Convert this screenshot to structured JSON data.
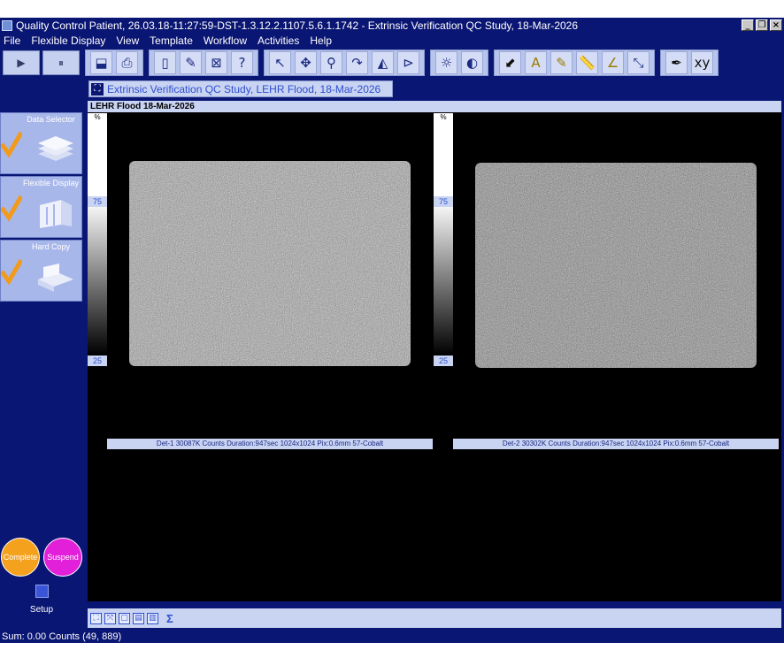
{
  "window": {
    "title": "Quality Control Patient, 26.03.18-11:27:59-DST-1.3.12.2.1107.5.6.1.1742 - Extrinsic Verification QC Study, 18-Mar-2026",
    "min_glyph": "_",
    "max_glyph": "❐",
    "close_glyph": "×"
  },
  "menu": [
    "File",
    "Flexible Display",
    "View",
    "Template",
    "Workflow",
    "Activities",
    "Help"
  ],
  "toolbar": {
    "play_glyph": "▶",
    "pause_glyph": "⏸",
    "groups": [
      [
        {
          "icon": "save-icon",
          "glyph": "⬓"
        },
        {
          "icon": "print-icon",
          "glyph": "⎙"
        }
      ],
      [
        {
          "icon": "new-doc-icon",
          "glyph": "▯"
        },
        {
          "icon": "edit-doc-icon",
          "glyph": "✎"
        },
        {
          "icon": "close-doc-icon",
          "glyph": "⊠"
        },
        {
          "icon": "help-doc-icon",
          "glyph": "?"
        }
      ],
      [
        {
          "icon": "pointer-icon",
          "glyph": "↖"
        },
        {
          "icon": "pan-icon",
          "glyph": "✥"
        },
        {
          "icon": "zoom-icon",
          "glyph": "⚲"
        },
        {
          "icon": "rotate-icon",
          "glyph": "↷"
        },
        {
          "icon": "flip-icon",
          "glyph": "◭"
        },
        {
          "icon": "cine-icon",
          "glyph": "⊳"
        }
      ],
      [
        {
          "icon": "brightness-icon",
          "glyph": "☼"
        },
        {
          "icon": "invert-icon",
          "glyph": "◐"
        }
      ],
      [
        {
          "icon": "arrow-annotation-icon",
          "glyph": "⬋"
        },
        {
          "icon": "text-annotation-icon",
          "glyph": "A"
        },
        {
          "icon": "label-annotation-icon",
          "glyph": "✎"
        },
        {
          "icon": "ruler-icon",
          "glyph": "📏"
        },
        {
          "icon": "angle-icon",
          "glyph": "∠"
        },
        {
          "icon": "distance-icon",
          "glyph": "⤡"
        }
      ],
      [
        {
          "icon": "draw-icon",
          "glyph": "✒"
        },
        {
          "icon": "xy-axis-icon",
          "glyph": "xy"
        }
      ]
    ]
  },
  "workflow": {
    "steps": [
      {
        "label": "Data Selector",
        "done": true
      },
      {
        "label": "Flexible Display",
        "done": true
      },
      {
        "label": "Hard Copy",
        "done": true
      }
    ],
    "complete_label": "Complete",
    "suspend_label": "Suspend",
    "setup_label": "Setup"
  },
  "document": {
    "tab_label": "Extrinsic Verification QC Study, LEHR Flood, 18-Mar-2026",
    "frame_title": "LEHR Flood 18-Mar-2026",
    "colorbar": {
      "unit": "%",
      "tick_high": "75",
      "tick_low": "25"
    },
    "images": [
      {
        "caption": "Det-1 30087K Counts Duration:947sec 1024x1024 Pix:0.6mm 57-Cobalt",
        "tone": "#8c8c8c"
      },
      {
        "caption": "Det-2 30302K Counts Duration:947sec 1024x1024 Pix:0.6mm 57-Cobalt",
        "tone": "#7a7a7a"
      }
    ],
    "bottom_tools": [
      "⛶",
      "⤧",
      "▢",
      "▤",
      "▥"
    ],
    "sigma_label": "Σ"
  },
  "status": "Sum: 0.00 Counts (49, 889)"
}
